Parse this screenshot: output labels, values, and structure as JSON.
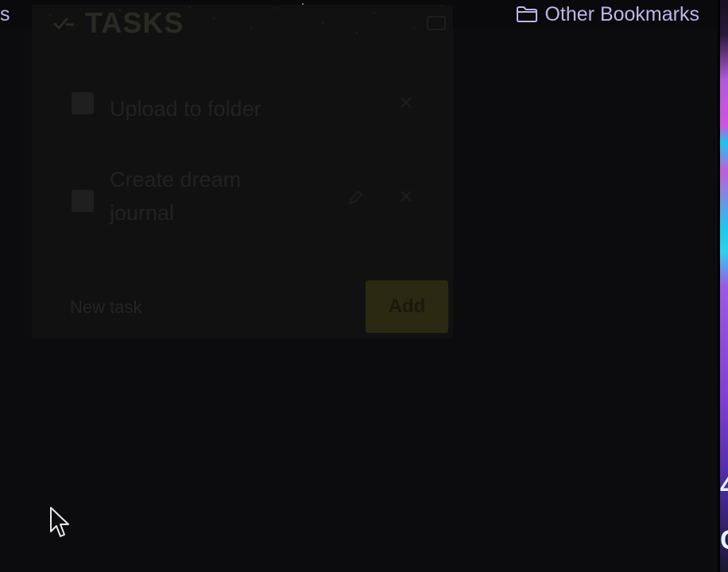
{
  "bookmarks_bar": {
    "left_fragment": "s",
    "other_bookmarks_label": "Other Bookmarks",
    "folder_icon": "folder-icon"
  },
  "app": {
    "title": "TASKS",
    "title_icon": "checklist-icon",
    "corner_icon": "settings-icon",
    "tasks": [
      {
        "text": "Upload to folder",
        "checked": false
      },
      {
        "text": "Create dream journal",
        "checked": false
      }
    ],
    "input_placeholder": "New task",
    "add_label": "Add"
  },
  "edge_fragments": [
    "4",
    "C"
  ],
  "colors": {
    "background": "#0c0c0e",
    "bookmark_text": "#bdb5e8",
    "edge_purple": "#c45cd8",
    "edge_cyan": "#1ec8ea"
  }
}
